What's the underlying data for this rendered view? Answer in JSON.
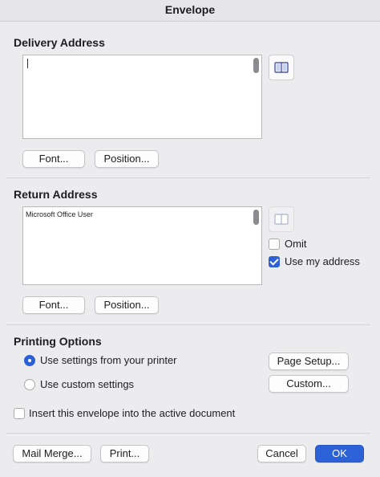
{
  "window": {
    "title": "Envelope"
  },
  "delivery": {
    "heading": "Delivery Address",
    "text": "",
    "address_book_icon": "address-book-icon",
    "font_button": "Font...",
    "position_button": "Position..."
  },
  "return": {
    "heading": "Return Address",
    "text": "Microsoft Office User",
    "address_book_icon": "address-book-icon",
    "omit_label": "Omit",
    "omit_checked": false,
    "use_my_address_label": "Use my address",
    "use_my_address_checked": true,
    "font_button": "Font...",
    "position_button": "Position..."
  },
  "printing": {
    "heading": "Printing Options",
    "option_printer": "Use settings from your printer",
    "option_custom": "Use custom settings",
    "selected": "printer",
    "page_setup_button": "Page Setup...",
    "custom_button": "Custom..."
  },
  "insert_label": "Insert this envelope into the active document",
  "insert_checked": false,
  "footer": {
    "mail_merge": "Mail Merge...",
    "print": "Print...",
    "cancel": "Cancel",
    "ok": "OK"
  },
  "colors": {
    "accent": "#2d61d8",
    "background": "#ecebee"
  }
}
